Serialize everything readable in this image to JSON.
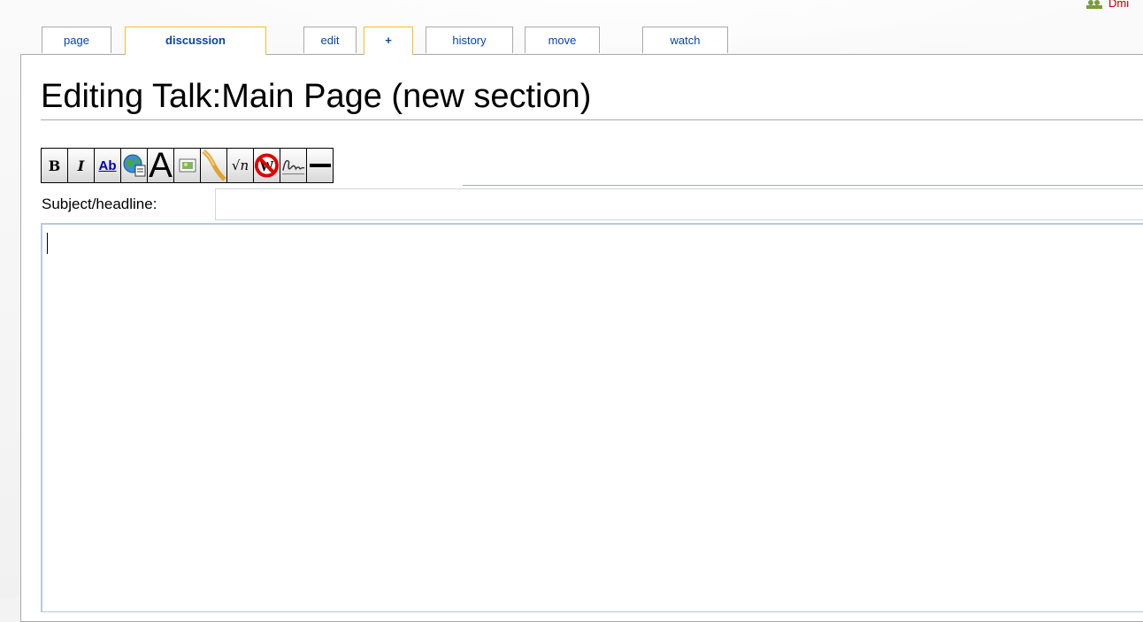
{
  "user": {
    "name": "Dmi"
  },
  "tabs": [
    {
      "label": "page"
    },
    {
      "label": "discussion"
    },
    {
      "label": "edit"
    },
    {
      "label": "+"
    },
    {
      "label": "history"
    },
    {
      "label": "move"
    },
    {
      "label": "watch"
    }
  ],
  "heading": "Editing Talk:Main Page (new section)",
  "toolbar": {
    "bold": "B",
    "italic": "I",
    "link": "Ab",
    "big_a": "A",
    "math": "√n"
  },
  "subject": {
    "label": "Subject/headline:",
    "value": ""
  },
  "editbox": {
    "value": ""
  }
}
